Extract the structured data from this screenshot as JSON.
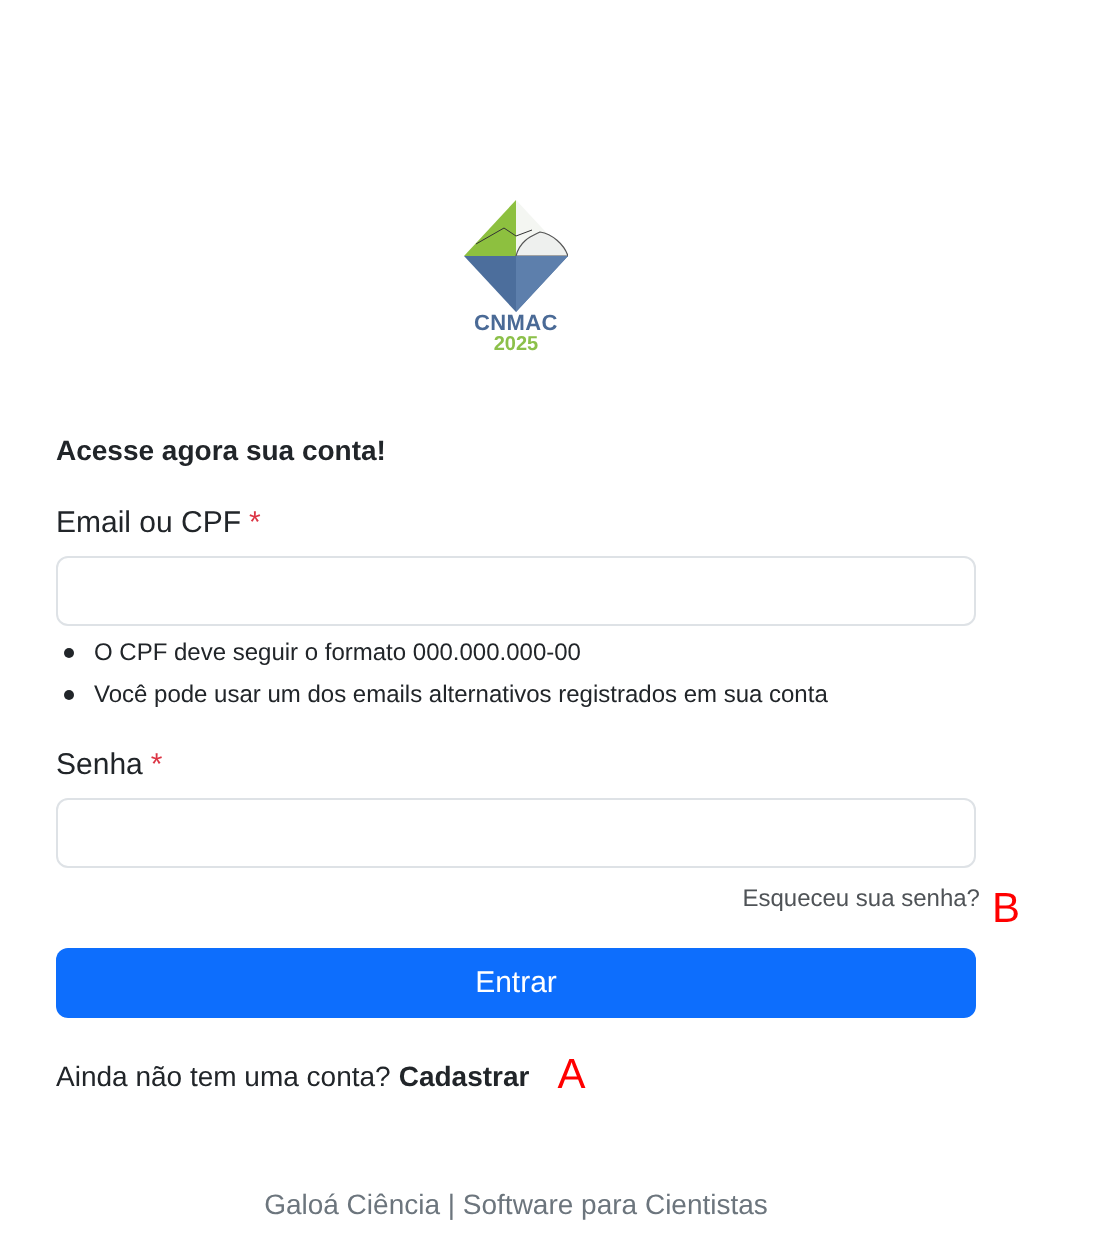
{
  "logo": {
    "title": "CNMAC",
    "year": "2025"
  },
  "heading": "Acesse agora sua conta!",
  "fields": [
    {
      "label": "Email ou CPF",
      "required_mark": "*",
      "hints": [
        "O CPF deve seguir o formato 000.000.000-00",
        "Você pode usar um dos emails alternativos registrados em sua conta"
      ]
    },
    {
      "label": "Senha",
      "required_mark": "*"
    }
  ],
  "forgot": {
    "link": "Esqueceu sua senha?",
    "annotation": "B"
  },
  "submit_button": "Entrar",
  "signup": {
    "prompt": "Ainda não tem uma conta?",
    "link": "Cadastrar",
    "annotation": "A"
  },
  "footer": "Galoá Ciência | Software para Cientistas"
}
